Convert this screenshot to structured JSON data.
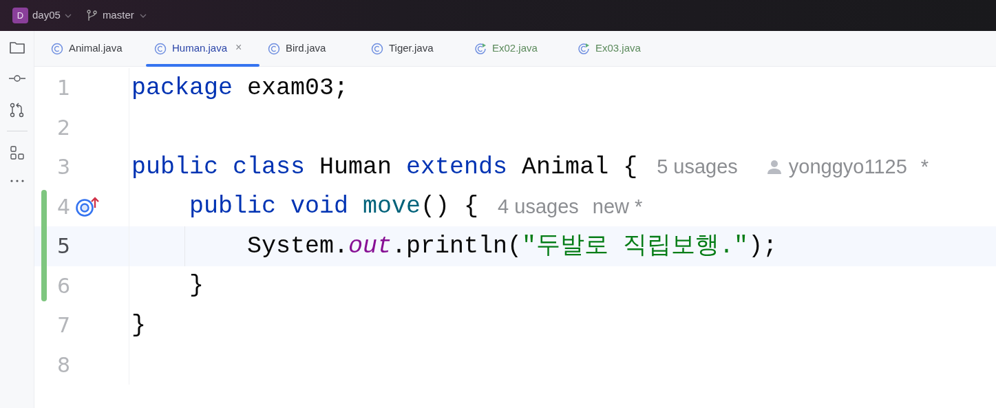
{
  "toolbar": {
    "project_badge": "D",
    "project": "day05",
    "branch": "master"
  },
  "tabs": [
    {
      "label": "Animal.java",
      "kind": "class",
      "added": false,
      "selected": false
    },
    {
      "label": "Human.java",
      "kind": "class",
      "added": false,
      "selected": true,
      "close": "×"
    },
    {
      "label": "Bird.java",
      "kind": "class",
      "added": false,
      "selected": false
    },
    {
      "label": "Tiger.java",
      "kind": "class",
      "added": false,
      "selected": false
    },
    {
      "label": "Ex02.java",
      "kind": "runnable",
      "added": true,
      "selected": false
    },
    {
      "label": "Ex03.java",
      "kind": "runnable",
      "added": true,
      "selected": false
    }
  ],
  "editor": {
    "lines": [
      {
        "number": "1",
        "changed": false,
        "current": false,
        "override": false,
        "tokens": [
          {
            "kind": "keyword",
            "text": "package"
          },
          {
            "kind": "plain",
            "text": " exam03;"
          }
        ]
      },
      {
        "number": "2",
        "changed": false,
        "current": false,
        "override": false
      },
      {
        "number": "3",
        "changed": false,
        "current": false,
        "override": false,
        "tokens": [
          {
            "kind": "keyword",
            "text": "public class"
          },
          {
            "kind": "plain",
            "text": " Human "
          },
          {
            "kind": "keyword",
            "text": "extends"
          },
          {
            "kind": "plain",
            "text": " Animal {"
          },
          {
            "kind": "hint",
            "text": "5 usages"
          },
          {
            "kind": "author",
            "text": "yonggyo1125"
          },
          {
            "kind": "hint",
            "text": "*"
          }
        ]
      },
      {
        "number": "4",
        "changed": true,
        "current": false,
        "override": true,
        "tokens": [
          {
            "kind": "keyword",
            "text": "    public void "
          },
          {
            "kind": "method",
            "text": "move"
          },
          {
            "kind": "plain",
            "text": "() {"
          },
          {
            "kind": "hint",
            "text": "4 usages"
          },
          {
            "kind": "hint",
            "text": "new *"
          }
        ]
      },
      {
        "number": "5",
        "changed": true,
        "current": true,
        "override": false,
        "tokens": [
          {
            "kind": "plain",
            "text": "        System."
          },
          {
            "kind": "field",
            "text": "out"
          },
          {
            "kind": "plain",
            "text": ".println("
          },
          {
            "kind": "string",
            "text": "\"두발로 직립보행.\""
          },
          {
            "kind": "plain",
            "text": ");"
          }
        ]
      },
      {
        "number": "6",
        "changed": true,
        "current": false,
        "override": false,
        "tokens": [
          {
            "kind": "plain",
            "text": "    }"
          }
        ]
      },
      {
        "number": "7",
        "changed": false,
        "current": false,
        "override": false,
        "tokens": [
          {
            "kind": "plain",
            "text": "}"
          }
        ]
      },
      {
        "number": "8",
        "changed": false,
        "current": false,
        "override": false
      }
    ]
  }
}
